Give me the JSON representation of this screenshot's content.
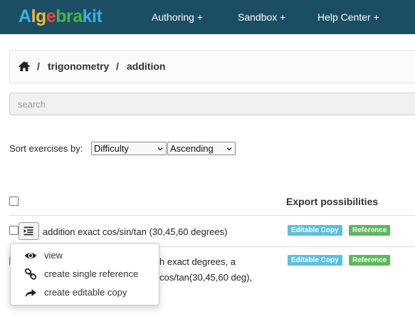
{
  "navbar": {
    "logo_parts": [
      "A",
      "lg",
      "e",
      "bra",
      "kit"
    ],
    "items": [
      {
        "label": "Authoring +"
      },
      {
        "label": "Sandbox +"
      },
      {
        "label": "Help Center +"
      }
    ],
    "colors": {
      "background": "#1c4e63",
      "text": "#ffffff"
    }
  },
  "breadcrumb": {
    "home_icon": "home-icon",
    "separator": "/",
    "items": [
      "trigonometry",
      "addition"
    ]
  },
  "search": {
    "placeholder": "search",
    "value": ""
  },
  "sort": {
    "label": "Sort exercises by:",
    "field": {
      "selected": "Difficulty"
    },
    "order": {
      "selected": "Ascending"
    }
  },
  "table": {
    "export_header": "Export possibilities",
    "rows": [
      {
        "title": "addition exact cos/sin/tan (30,45,60 degrees)",
        "badges": [
          "Editable Copy",
          "Reference"
        ]
      },
      {
        "text_lines": [
          "h exact degrees, a",
          "cos/tan(30,45,60 deg),"
        ],
        "badges": [
          "Editable Copy",
          "Reference"
        ]
      }
    ]
  },
  "row_menu": {
    "items": [
      {
        "label": "view",
        "icon": "eye-icon"
      },
      {
        "label": "create single reference",
        "icon": "link-icon"
      },
      {
        "label": "create editable copy",
        "icon": "share-arrow-icon"
      }
    ]
  },
  "colors": {
    "badge_editable": "#5bc0de",
    "badge_reference": "#5cb85c",
    "logo_blue": "#3bb0e6",
    "logo_orange": "#f5b63b",
    "logo_red": "#e64a3b",
    "logo_green": "#45b649"
  }
}
